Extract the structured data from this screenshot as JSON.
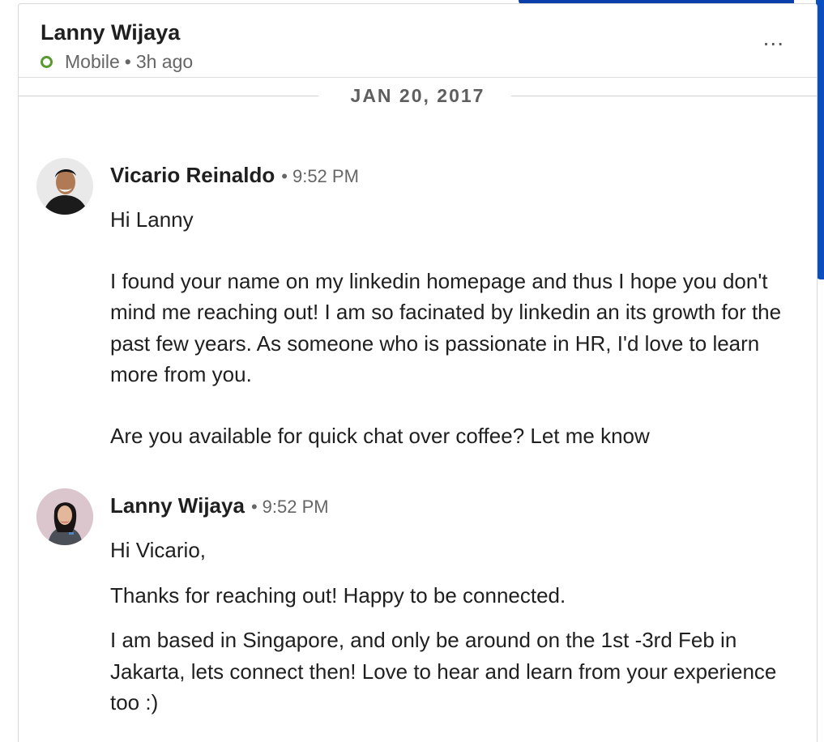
{
  "header": {
    "contact_name": "Lanny Wijaya",
    "status_device": "Mobile",
    "status_separator": "•",
    "status_time": "3h ago",
    "more_label": "..."
  },
  "date_divider": "JAN 20, 2017",
  "messages": [
    {
      "sender": "Vicario Reinaldo",
      "separator": "•",
      "time": "9:52 PM",
      "paragraphs": [
        "Hi Lanny",
        "I found your name on my linkedin homepage and thus I hope you don't mind me reaching out! I am so facinated by linkedin an its growth for the past few years. As someone who is passionate in HR, I'd love to learn more from you.",
        "Are you available for quick chat over coffee? Let me know"
      ]
    },
    {
      "sender": "Lanny Wijaya",
      "separator": "•",
      "time": "9:52 PM",
      "paragraphs": [
        "Hi Vicario,",
        "Thanks for reaching out! Happy to be connected.",
        "I am based in Singapore, and only be around on the 1st -3rd Feb in Jakarta, lets connect then! Love to hear and learn from your experience too :)"
      ]
    }
  ],
  "colors": {
    "status_online": "#5a9a2f",
    "accent_blue": "#0a3ea8"
  }
}
